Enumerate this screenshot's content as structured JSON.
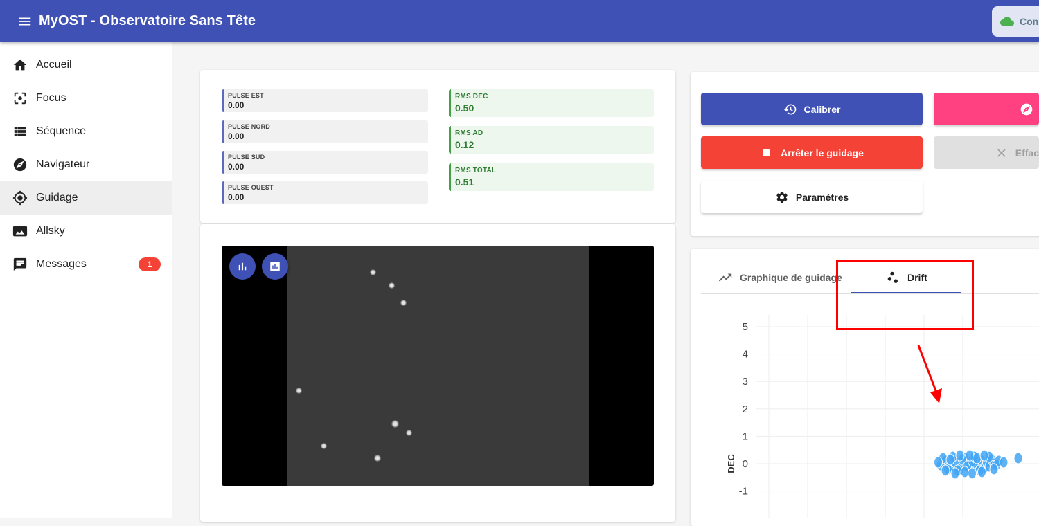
{
  "appbar": {
    "title": "MyOST - Observatoire Sans Tête",
    "connection_label": "Conn",
    "connection_icon": "cloud-done-icon"
  },
  "sidebar": {
    "items": [
      {
        "label": "Accueil",
        "icon": "home-icon"
      },
      {
        "label": "Focus",
        "icon": "center-focus-icon"
      },
      {
        "label": "Séquence",
        "icon": "list-icon"
      },
      {
        "label": "Navigateur",
        "icon": "explore-icon"
      },
      {
        "label": "Guidage",
        "icon": "gps-fixed-icon",
        "active": true
      },
      {
        "label": "Allsky",
        "icon": "panorama-icon"
      },
      {
        "label": "Messages",
        "icon": "message-icon",
        "badge": "1"
      }
    ]
  },
  "pulses": [
    {
      "label": "PULSE EST",
      "value": "0.00"
    },
    {
      "label": "PULSE NORD",
      "value": "0.00"
    },
    {
      "label": "PULSE SUD",
      "value": "0.00"
    },
    {
      "label": "PULSE OUEST",
      "value": "0.00"
    }
  ],
  "rms": [
    {
      "label": "RMS DEC",
      "value": "0.50"
    },
    {
      "label": "RMS AD",
      "value": "0.12"
    },
    {
      "label": "RMS TOTAL",
      "value": "0.51"
    }
  ],
  "actions": {
    "calibrate": "Calibrer",
    "stop": "Arrêter le guidage",
    "clear": "Effac",
    "settings": "Paramètres"
  },
  "tabs": {
    "guiding_chart": "Graphique de guidage",
    "drift": "Drift"
  },
  "colors": {
    "primary": "#3f51b5",
    "danger": "#f44336",
    "accent": "#ff4081",
    "highlight": "#ff0000",
    "points": "#42a5f5"
  },
  "chart_data": {
    "type": "scatter",
    "ylabel": "DEC",
    "ylim": [
      -2,
      5
    ],
    "yticks": [
      "5",
      "4",
      "3",
      "2",
      "1",
      "0",
      "-1"
    ],
    "grid": true,
    "series": [
      {
        "points": [
          [
            -0.2,
            0.1
          ],
          [
            -0.1,
            -0.1
          ],
          [
            0.0,
            0.05
          ],
          [
            0.1,
            -0.2
          ],
          [
            0.2,
            0.2
          ],
          [
            0.3,
            0.0
          ],
          [
            -0.3,
            -0.05
          ],
          [
            0.15,
            0.15
          ],
          [
            0.25,
            -0.1
          ],
          [
            0.35,
            0.1
          ],
          [
            -0.25,
            0.2
          ],
          [
            0.05,
            -0.25
          ],
          [
            0.45,
            -0.05
          ],
          [
            0.55,
            0.1
          ],
          [
            -0.05,
            0.25
          ],
          [
            0.6,
            -0.15
          ],
          [
            0.4,
            0.25
          ],
          [
            0.5,
            -0.25
          ],
          [
            -0.15,
            -0.2
          ],
          [
            0.65,
            0.05
          ],
          [
            0.7,
            -0.1
          ],
          [
            0.75,
            0.15
          ],
          [
            0.8,
            0.0
          ],
          [
            -0.35,
            0.05
          ],
          [
            0.2,
            -0.3
          ],
          [
            0.3,
            0.3
          ],
          [
            0.1,
            0.3
          ],
          [
            -0.1,
            0.15
          ],
          [
            0.45,
            0.2
          ],
          [
            0.85,
            -0.05
          ],
          [
            0.9,
            0.1
          ],
          [
            0.55,
            -0.3
          ],
          [
            0.7,
            0.25
          ],
          [
            0.6,
            0.3
          ],
          [
            -0.2,
            -0.25
          ],
          [
            0.0,
            -0.35
          ],
          [
            0.35,
            -0.35
          ],
          [
            0.8,
            -0.2
          ],
          [
            1.0,
            0.05
          ],
          [
            1.3,
            0.2
          ]
        ]
      }
    ]
  }
}
